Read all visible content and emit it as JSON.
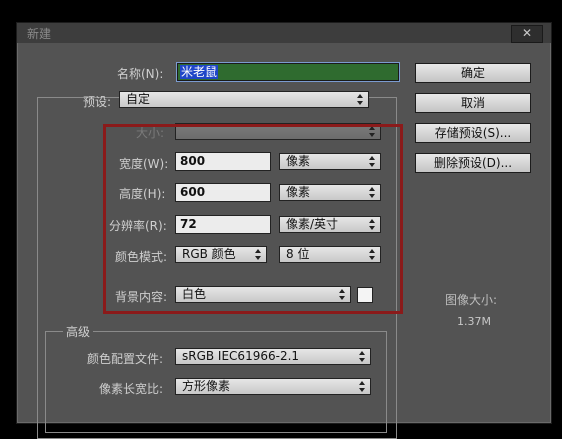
{
  "dialog": {
    "title": "新建",
    "close_icon": "✕"
  },
  "form": {
    "name_label": "名称(N):",
    "name_value": "米老鼠",
    "preset_label": "预设:",
    "preset_value": "自定",
    "size_label": "大小:",
    "size_value": "",
    "width_label": "宽度(W):",
    "width_value": "800",
    "width_unit": "像素",
    "height_label": "高度(H):",
    "height_value": "600",
    "height_unit": "像素",
    "resolution_label": "分辨率(R):",
    "resolution_value": "72",
    "resolution_unit": "像素/英寸",
    "color_mode_label": "颜色模式:",
    "color_mode_value": "RGB 颜色",
    "bit_depth_value": "8 位",
    "bg_label": "背景内容:",
    "bg_value": "白色",
    "bg_swatch_color": "#f4f4f4"
  },
  "advanced": {
    "title": "高级",
    "color_profile_label": "颜色配置文件:",
    "color_profile_value": "sRGB IEC61966-2.1",
    "pixel_aspect_label": "像素长宽比:",
    "pixel_aspect_value": "方形像素"
  },
  "buttons": {
    "ok": "确定",
    "cancel": "取消",
    "save_preset": "存储预设(S)...",
    "delete_preset": "删除预设(D)..."
  },
  "image_size": {
    "label": "图像大小:",
    "value": "1.37M"
  },
  "colors": {
    "highlight_box": "#8b1a1a",
    "name_field_bg": "#2f6b2f",
    "selection": "#1f46c8"
  }
}
